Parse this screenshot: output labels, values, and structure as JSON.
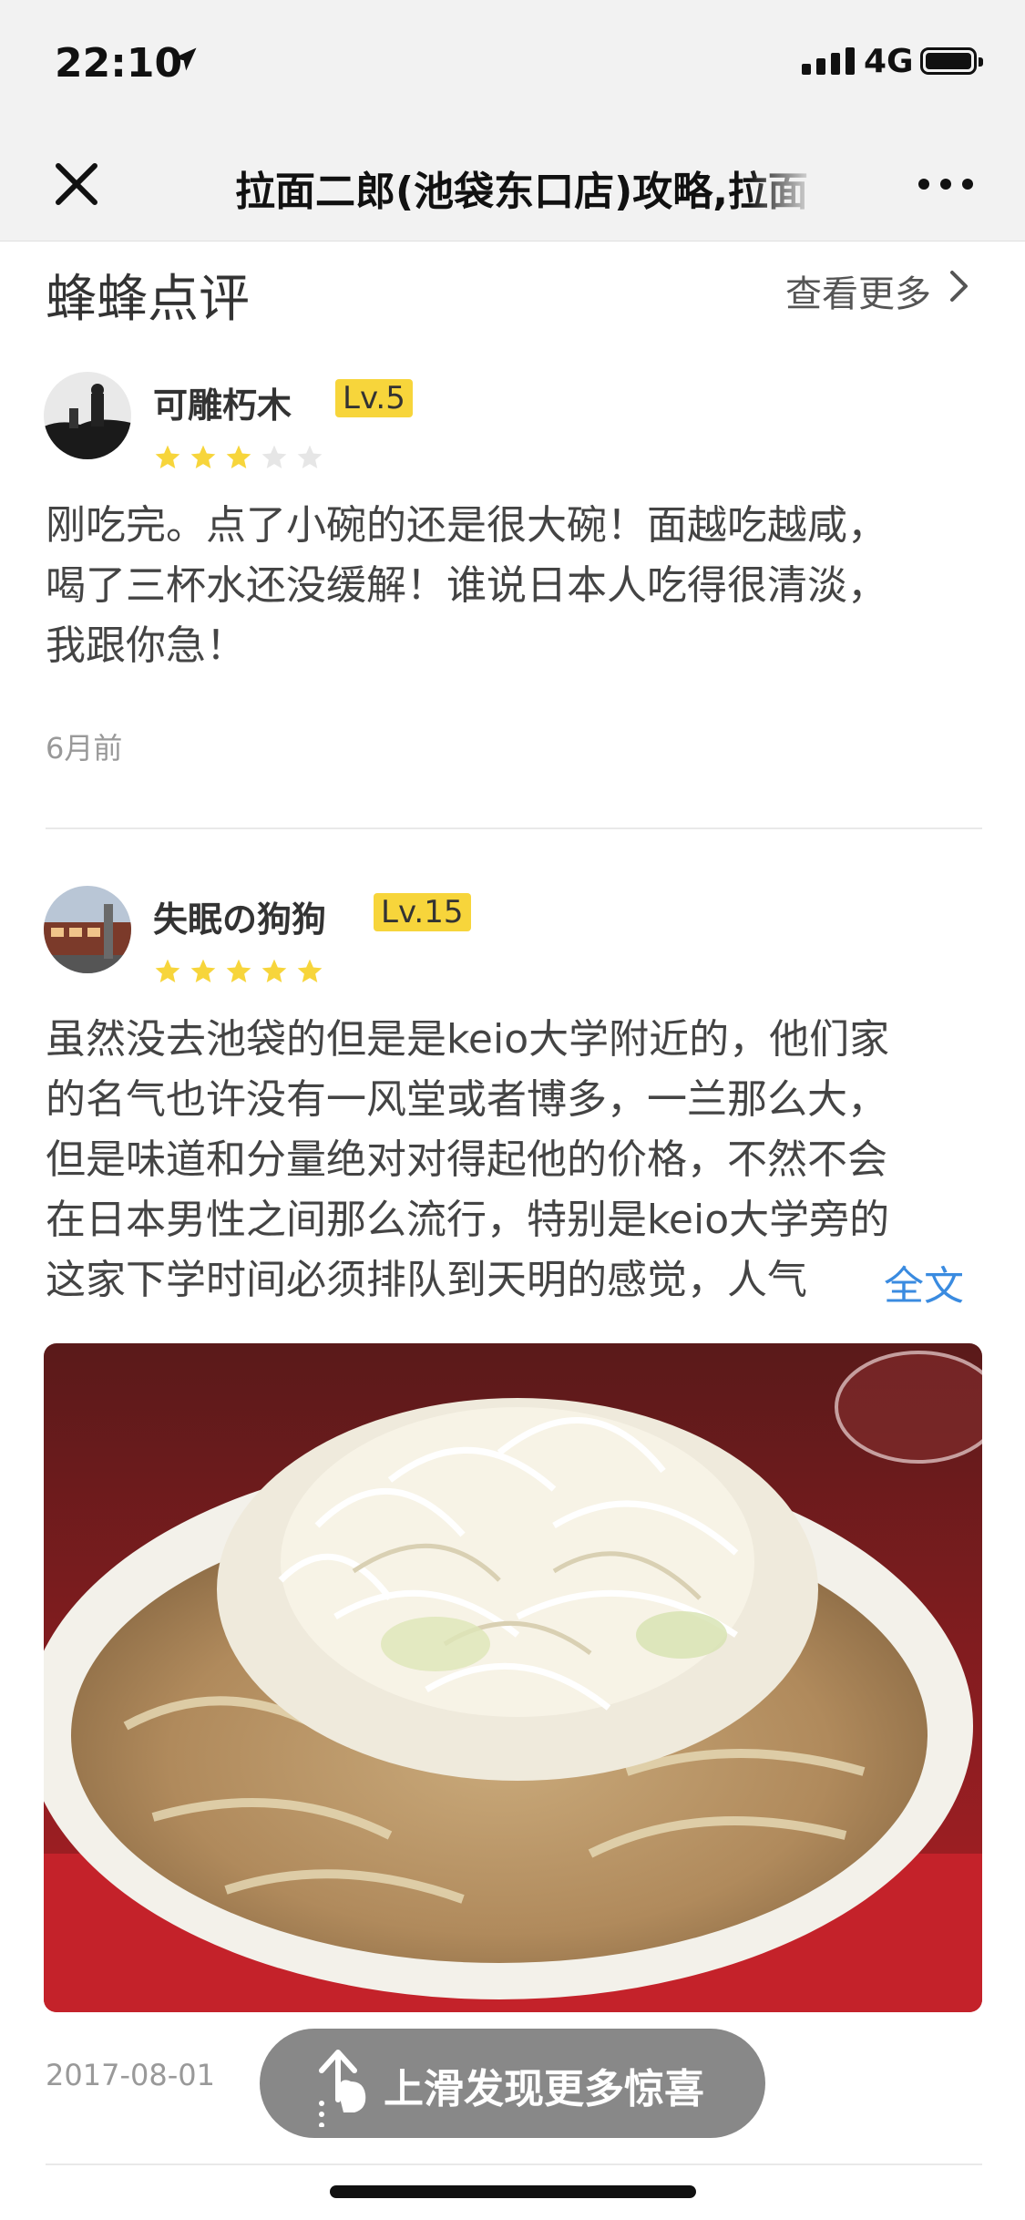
{
  "status_bar": {
    "time": "22:10",
    "network": "4G"
  },
  "nav": {
    "title": "拉面二郎(池袋东口店)攻略,拉面"
  },
  "section": {
    "title": "蜂蜂点评",
    "see_more": "查看更多"
  },
  "reviews": [
    {
      "user": "可雕朽木",
      "level": "Lv.5",
      "rating": 3,
      "max_rating": 5,
      "lines": [
        "刚吃完。点了小碗的还是很大碗！面越吃越咸，",
        "喝了三杯水还没缓解！谁说日本人吃得很清淡，",
        "我跟你急！"
      ],
      "date": "6月前"
    },
    {
      "user": "失眠の狗狗",
      "level": "Lv.15",
      "rating": 5,
      "max_rating": 5,
      "lines": [
        "虽然没去池袋的但是是keio大学附近的，他们家",
        "的名气也许没有一风堂或者博多，一兰那么大，",
        "但是味道和分量绝对对得起他的价格，不然不会",
        "在日本男性之间那么流行，特别是keio大学旁的",
        "这家下学时间必须排队到天明的感觉，人气"
      ],
      "full_text_link": "全文",
      "date": "2017-08-01"
    }
  ],
  "floating_tip": {
    "text": "上滑发现更多惊喜"
  },
  "colors": {
    "badge": "#f7d53b",
    "star": "#f7d53b",
    "star_empty": "#e6e6e6",
    "link": "#3a8be0"
  }
}
